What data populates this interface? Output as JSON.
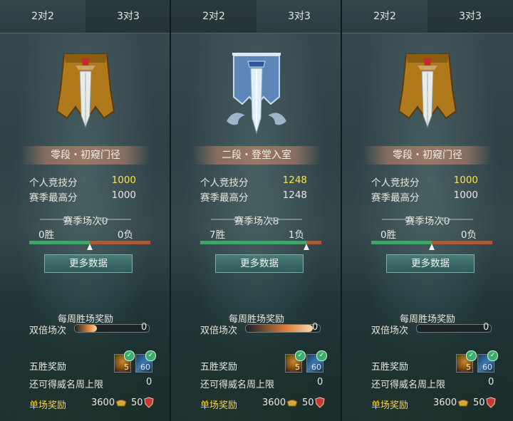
{
  "panels": [
    {
      "tabs": [
        "2对2",
        "3对3"
      ],
      "active_tab": 0,
      "emblem": "gold-banner-sword-icon",
      "rank": "零段・初窥门径",
      "score_label": "个人竞技分",
      "score": "1000",
      "best_label": "赛季最高分",
      "best": "1000",
      "season_label": "赛季场次0",
      "wins": "0胜",
      "losses": "0负",
      "win_ratio": 0.5,
      "more_button": "更多数据",
      "weekly_title": "每周胜场奖励",
      "double_label": "双倍场次",
      "double_value": "0",
      "double_fill": 0.3,
      "five_win_label": "五胜奖励",
      "item1_count": "5",
      "item2_count": "60",
      "remaining_label": "还可得威名周上限",
      "remaining_value": "0",
      "single_label": "单场奖励",
      "single_coin": "3600",
      "single_fame": "50"
    },
    {
      "tabs": [
        "2对2",
        "3对3"
      ],
      "active_tab": 1,
      "emblem": "silver-banner-sword-icon",
      "rank": "二段・登堂入室",
      "score_label": "个人竞技分",
      "score": "1248",
      "best_label": "赛季最高分",
      "best": "1248",
      "season_label": "赛季场次8",
      "wins": "7胜",
      "losses": "1负",
      "win_ratio": 0.875,
      "more_button": "更多数据",
      "weekly_title": "每周胜场奖励",
      "double_label": "双倍场次",
      "double_value": "0",
      "double_fill": 0.9,
      "five_win_label": "五胜奖励",
      "item1_count": "5",
      "item2_count": "60",
      "remaining_label": "还可得威名周上限",
      "remaining_value": "0",
      "single_label": "单场奖励",
      "single_coin": "3600",
      "single_fame": "50"
    },
    {
      "tabs": [
        "2对2",
        "3对3"
      ],
      "active_tab": 0,
      "emblem": "gold-banner-sword-icon",
      "rank": "零段・初窥门径",
      "score_label": "个人竞技分",
      "score": "1000",
      "best_label": "赛季最高分",
      "best": "1000",
      "season_label": "赛季场次0",
      "wins": "0胜",
      "losses": "0负",
      "win_ratio": 0.5,
      "more_button": "更多数据",
      "weekly_title": "每周胜场奖励",
      "double_label": "双倍场次",
      "double_value": "0",
      "double_fill": 0.0,
      "five_win_label": "五胜奖励",
      "item1_count": "5",
      "item2_count": "60",
      "remaining_label": "还可得威名周上限",
      "remaining_value": "0",
      "single_label": "单场奖励",
      "single_coin": "3600",
      "single_fame": "50"
    }
  ],
  "colors": {
    "score_highlight": "#ffe046",
    "reward_gold": "#ffd23c",
    "win_track": "#3fa46a",
    "loss_track": "#a85a3a"
  }
}
